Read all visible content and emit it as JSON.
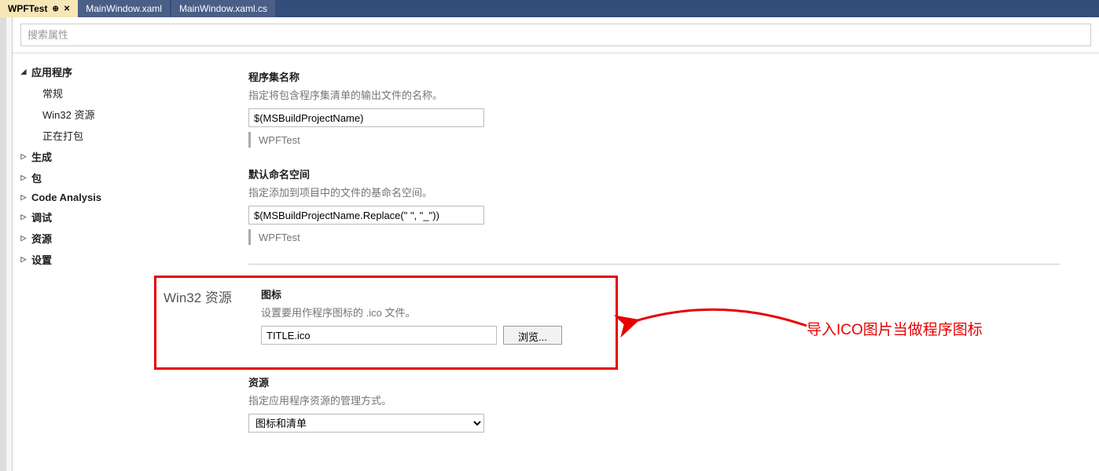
{
  "tabs": [
    {
      "label": "WPFTest",
      "active": true,
      "pinned": true,
      "closable": true
    },
    {
      "label": "MainWindow.xaml",
      "active": false
    },
    {
      "label": "MainWindow.xaml.cs",
      "active": false
    }
  ],
  "search_placeholder": "搜索属性",
  "sidebar": {
    "items": [
      {
        "label": "应用程序",
        "level": 0,
        "expanded": true
      },
      {
        "label": "常规",
        "level": 1
      },
      {
        "label": "Win32 资源",
        "level": 1
      },
      {
        "label": "正在打包",
        "level": 1
      },
      {
        "label": "生成",
        "level": 0,
        "expanded": false
      },
      {
        "label": "包",
        "level": 0,
        "expanded": false
      },
      {
        "label": "Code Analysis",
        "level": 0,
        "expanded": false
      },
      {
        "label": "调试",
        "level": 0,
        "expanded": false
      },
      {
        "label": "资源",
        "level": 0,
        "expanded": false
      },
      {
        "label": "设置",
        "level": 0,
        "expanded": false
      }
    ]
  },
  "content": {
    "assembly_name": {
      "label": "程序集名称",
      "desc": "指定将包含程序集清单的输出文件的名称。",
      "value": "$(MSBuildProjectName)",
      "resolved": "WPFTest"
    },
    "default_namespace": {
      "label": "默认命名空间",
      "desc": "指定添加到项目中的文件的基命名空间。",
      "value": "$(MSBuildProjectName.Replace(\" \", \"_\"))",
      "resolved": "WPFTest"
    },
    "win32_section_title": "Win32 资源",
    "icon": {
      "label": "图标",
      "desc": "设置要用作程序图标的 .ico 文件。",
      "value": "TITLE.ico",
      "browse": "浏览..."
    },
    "resources": {
      "label": "资源",
      "desc": "指定应用程序资源的管理方式。",
      "selected": "图标和清单"
    }
  },
  "annotation_text": "导入ICO图片当做程序图标"
}
